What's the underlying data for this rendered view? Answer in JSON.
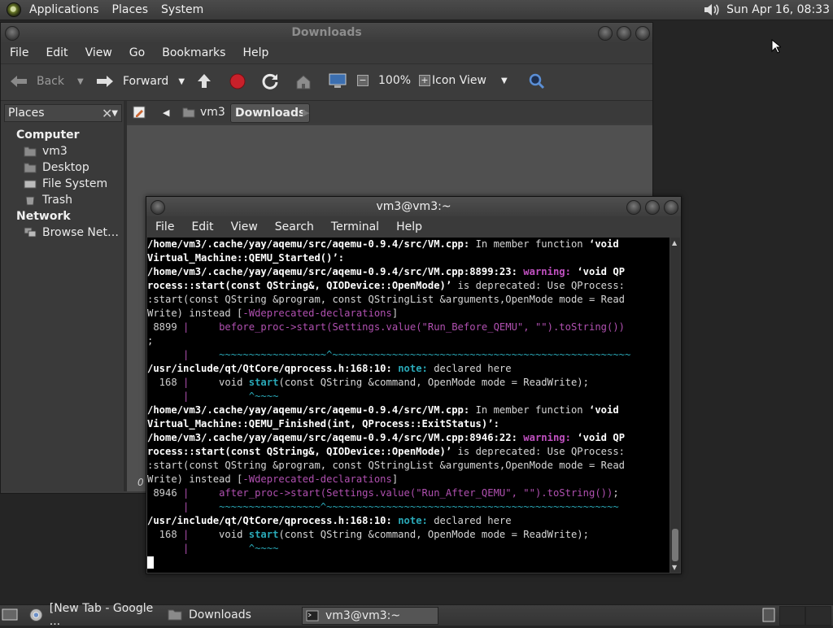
{
  "top_panel": {
    "menus": [
      "Applications",
      "Places",
      "System"
    ],
    "clock": "Sun Apr 16, 08:33"
  },
  "file_manager": {
    "title": "Downloads",
    "menus": [
      "File",
      "Edit",
      "View",
      "Go",
      "Bookmarks",
      "Help"
    ],
    "toolbar": {
      "back": "Back",
      "forward": "Forward",
      "zoom": "100%",
      "view_mode": "Icon View"
    },
    "sidebar": {
      "header": "Places",
      "groups": [
        {
          "label": "Computer",
          "items": [
            "vm3",
            "Desktop",
            "File System",
            "Trash"
          ]
        },
        {
          "label": "Network",
          "items": [
            "Browse Net…"
          ]
        }
      ]
    },
    "path": [
      "vm3",
      "Downloads"
    ],
    "status_fragment": "0"
  },
  "terminal": {
    "title": "vm3@vm3:~",
    "menus": [
      "File",
      "Edit",
      "View",
      "Search",
      "Terminal",
      "Help"
    ],
    "lines": [
      "/home/vm3/.cache/yay/aqemu/src/aqemu-0.9.4/src/VM.cpp: In member function ‘void",
      "Virtual_Machine::QEMU_Started()’:",
      "/home/vm3/.cache/yay/aqemu/src/aqemu-0.9.4/src/VM.cpp:8899:23: warning: ‘void QP",
      "rocess::start(const QString&, QIODevice::OpenMode)’ is deprecated: Use QProcess:",
      ":start(const QString &program, const QStringList &arguments,OpenMode mode = Read",
      "Write) instead [-Wdeprecated-declarations]",
      " 8899 |     before_proc->start(Settings.value(\"Run_Before_QEMU\", \"\").toString())",
      ";",
      "      |     ~~~~~~~~~~~~~~~~~~^~~~~~~~~~~~~~~~~~~~~~~~~~~~~~~~~~~~~~~~~~~~~~~~~~~",
      "/usr/include/qt/QtCore/qprocess.h:168:10: note: declared here",
      "  168 |     void start(const QString &command, OpenMode mode = ReadWrite);",
      "      |          ^~~~~",
      "/home/vm3/.cache/yay/aqemu/src/aqemu-0.9.4/src/VM.cpp: In member function ‘void",
      "Virtual_Machine::QEMU_Finished(int, QProcess::ExitStatus)’:",
      "/home/vm3/.cache/yay/aqemu/src/aqemu-0.9.4/src/VM.cpp:8946:22: warning: ‘void QP",
      "rocess::start(const QString&, QIODevice::OpenMode)’ is deprecated: Use QProcess:",
      ":start(const QString &program, const QStringList &arguments,OpenMode mode = Read",
      "Write) instead [-Wdeprecated-declarations]",
      " 8946 |     after_proc->start(Settings.value(\"Run_After_QEMU\", \"\").toString());",
      "      |     ~~~~~~~~~~~~~~~~~^~~~~~~~~~~~~~~~~~~~~~~~~~~~~~~~~~~~~~~~~~~~~~~~~~",
      "/usr/include/qt/QtCore/qprocess.h:168:10: note: declared here",
      "  168 |     void start(const QString &command, OpenMode mode = ReadWrite);",
      "      |          ^~~~~"
    ]
  },
  "taskbar": {
    "tasks": [
      "[New Tab - Google ...",
      "Downloads",
      "vm3@vm3:~"
    ]
  }
}
